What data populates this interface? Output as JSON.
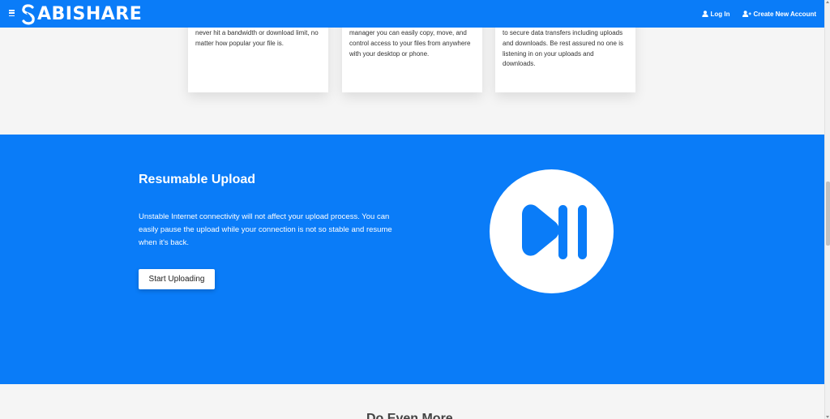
{
  "navbar": {
    "logo_text": "ABISHARE",
    "login_label": "Log In",
    "create_account_label": "Create New Account"
  },
  "cards": [
    {
      "text": "never hit a bandwidth or download limit, no matter how popular your file is."
    },
    {
      "text": "manager you can easily copy, move, and control access to your files from anywhere with your desktop or phone."
    },
    {
      "text": "to secure data transfers including uploads and downloads. Be rest assured no one is listening in on your uploads and downloads."
    }
  ],
  "resumable": {
    "title": "Resumable Upload",
    "description": "Unstable Internet connectivity will not affect your upload process. You can easily pause the upload while your connection is not so stable and resume when it's back.",
    "button_label": "Start Uploading"
  },
  "next_section": {
    "heading": "Do Even More"
  },
  "colors": {
    "brand_blue": "#0a7cf8",
    "white": "#ffffff",
    "page_bg": "#f5f5f5"
  },
  "icons": [
    "menu-icon",
    "logo-icon",
    "user-icon",
    "user-plus-icon",
    "play-pause-icon"
  ]
}
